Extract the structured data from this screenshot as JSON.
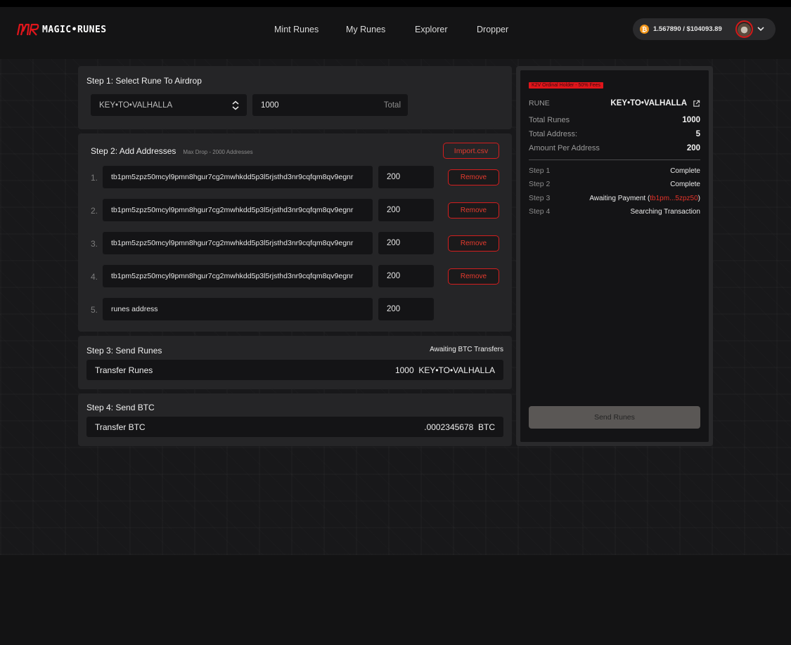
{
  "header": {
    "logo_text": "MAGIC•RUNES",
    "nav": [
      "Mint Runes",
      "My Runes",
      "Explorer",
      "Dropper"
    ],
    "wallet_text": "1.567890 / $104093.89",
    "btc_symbol": "₿"
  },
  "step1": {
    "title": "Step 1: Select Rune To Airdrop",
    "rune_select": "KEY•TO•VALHALLA",
    "total_value": "1000",
    "total_suffix": "Total"
  },
  "step2": {
    "title": "Step 2: Add Addresses",
    "subtitle": "Max Drop - 2000 Addresses",
    "import_label": "Import.csv",
    "remove_label": "Remove",
    "rows": [
      {
        "num": "1.",
        "address": "tb1pm5zpz50mcyl9pmn8hgur7cg2mwhkdd5p3l5rjsthd3nr9cqfqm8qv9egnr",
        "amount": "200"
      },
      {
        "num": "2.",
        "address": "tb1pm5zpz50mcyl9pmn8hgur7cg2mwhkdd5p3l5rjsthd3nr9cqfqm8qv9egnr",
        "amount": "200"
      },
      {
        "num": "3.",
        "address": "tb1pm5zpz50mcyl9pmn8hgur7cg2mwhkdd5p3l5rjsthd3nr9cqfqm8qv9egnr",
        "amount": "200"
      },
      {
        "num": "4.",
        "address": "tb1pm5zpz50mcyl9pmn8hgur7cg2mwhkdd5p3l5rjsthd3nr9cqfqm8qv9egnr",
        "amount": "200"
      },
      {
        "num": "5.",
        "address_placeholder": "runes address",
        "amount": "200"
      }
    ]
  },
  "step3": {
    "title": "Step 3: Send Runes",
    "status": "Awaiting BTC Transfers",
    "label": "Transfer Runes",
    "value": "1000  KEY•TO•VALHALLA"
  },
  "step4": {
    "title": "Step 4: Send BTC",
    "label": "Transfer BTC",
    "value": ".0002345678  BTC"
  },
  "summary": {
    "fee_badge": "K2V Ordinal Holder - 50% Fees",
    "rune_label": "RUNE",
    "rune_value": "KEY•TO•VALHALLA",
    "total_runes_label": "Total Runes",
    "total_runes_value": "1000",
    "total_address_label": "Total Address:",
    "total_address_value": "5",
    "amount_per_label": "Amount Per Address",
    "amount_per_value": "200",
    "steps": [
      {
        "label": "Step 1",
        "status": "Complete"
      },
      {
        "label": "Step 2",
        "status": "Complete"
      },
      {
        "label": "Step 3",
        "status_prefix": "Awaiting Payment (",
        "status_highlight": "tb1pm...5zpz50",
        "status_suffix": ")"
      },
      {
        "label": "Step 4",
        "status": "Searching Transaction"
      }
    ],
    "send_button": "Send Runes"
  },
  "colors": {
    "accent_red": "#e0151b",
    "background": "#141415",
    "panel": "#252527",
    "field": "#141416"
  },
  "icons": [
    "logo-mark-icon",
    "bitcoin-icon",
    "chevron-down-icon",
    "updown-chevron-icon",
    "external-link-icon"
  ]
}
